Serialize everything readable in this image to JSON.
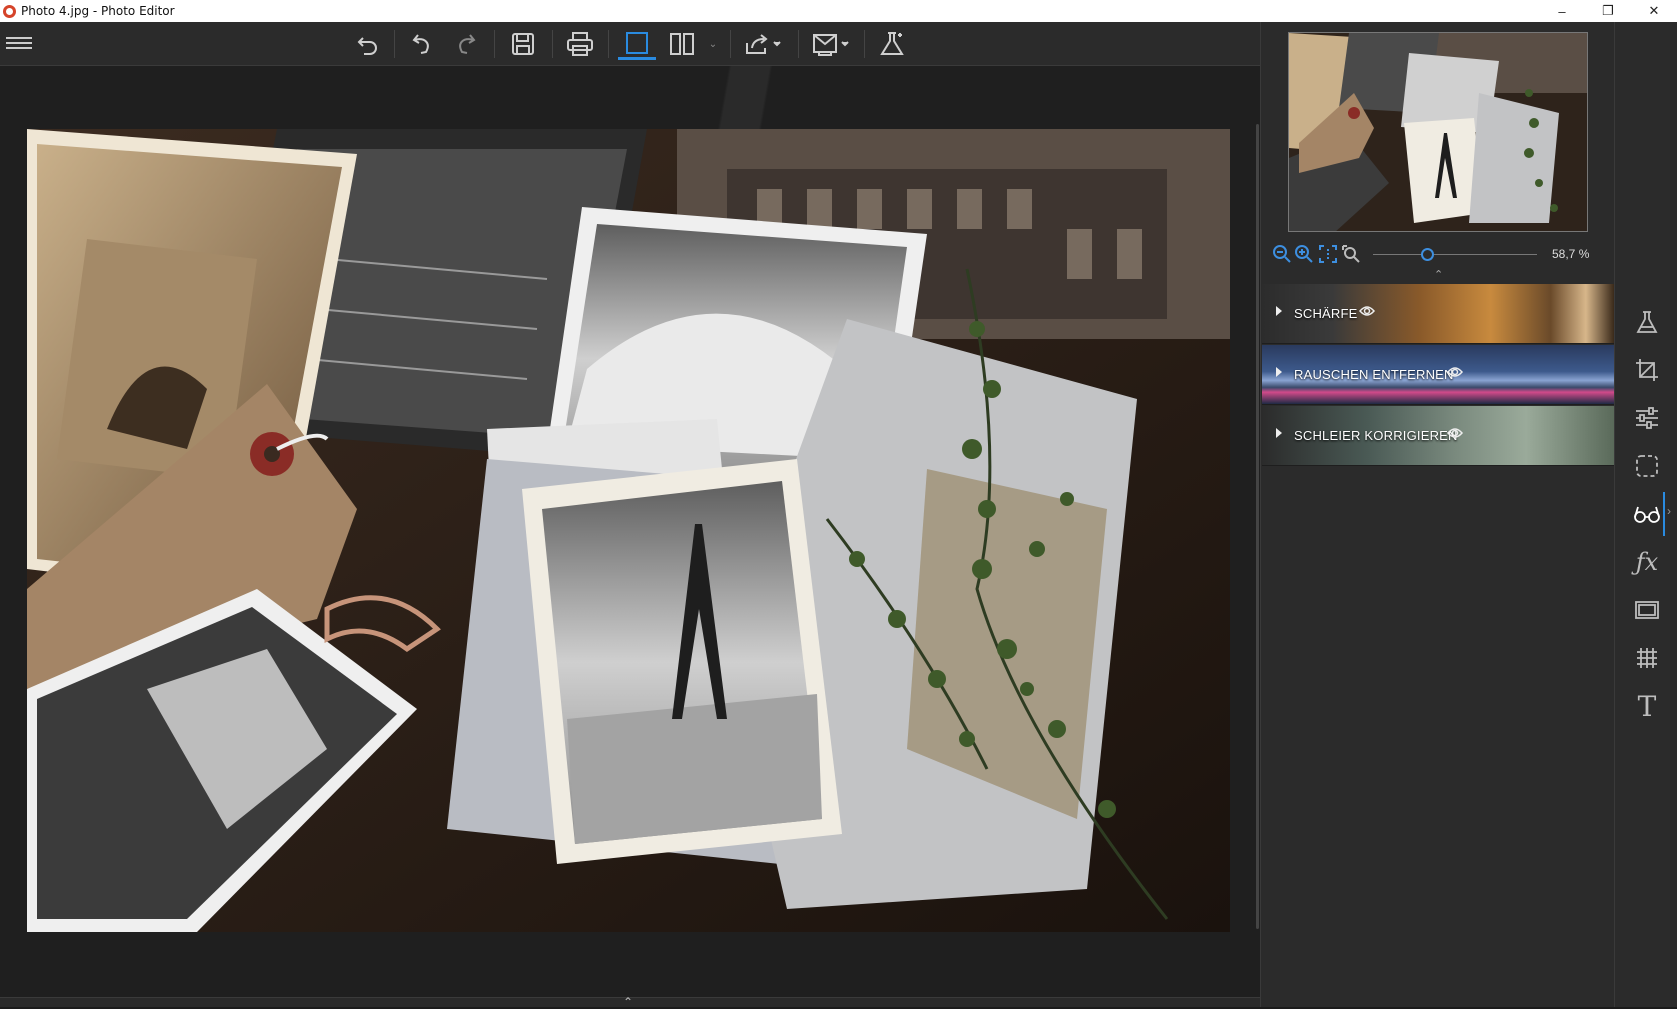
{
  "window": {
    "title": "Photo 4.jpg - Photo Editor",
    "controls": [
      "–",
      "❐",
      "✕"
    ]
  },
  "toolbar": {
    "buttons": [
      {
        "name": "undo-all",
        "icon": "undo-all-icon"
      },
      {
        "name": "undo",
        "icon": "undo-icon"
      },
      {
        "name": "redo",
        "icon": "redo-icon"
      },
      {
        "name": "save",
        "icon": "save-icon"
      },
      {
        "name": "print",
        "icon": "print-icon"
      },
      {
        "name": "single-view",
        "icon": "single-view-icon",
        "active": true
      },
      {
        "name": "compare-view",
        "icon": "split-view-icon"
      },
      {
        "name": "share",
        "icon": "share-icon"
      },
      {
        "name": "export",
        "icon": "export-icon"
      },
      {
        "name": "lab",
        "icon": "flask-icon"
      }
    ]
  },
  "navigator": {
    "zoom_value": "58,7 %",
    "zoom_fraction": 0.33
  },
  "adjustments": [
    {
      "label": "SCHÄRFE",
      "bg": "linear-gradient(90deg,#2c2c2c 0%,#3a3a3a 20%,#8a5a2a 45%,#c88a3e 65%,#6a4a2a 82%,#d7b68a 92%,#3a2a1a 100%)"
    },
    {
      "label": "RAUSCHEN ENTFERNEN",
      "bg": "linear-gradient(180deg,#2a3a5e 0%,#3d5a8c 45%,#8aa4d2 60%,#3a4a6a 72%,#d04a8a 80%,#1e2a44 100%)"
    },
    {
      "label": "SCHLEIER KORRIGIEREN",
      "bg": "linear-gradient(90deg,#2b2b2b 0%,#4a5a55 30%,#7a8a7e 55%,#9aaa9a 75%,#5a6a5a 100%)"
    }
  ],
  "colors": {
    "accent": "#2a8be0",
    "panel": "#2b2b2b",
    "canvas": "#1f1f1f"
  }
}
